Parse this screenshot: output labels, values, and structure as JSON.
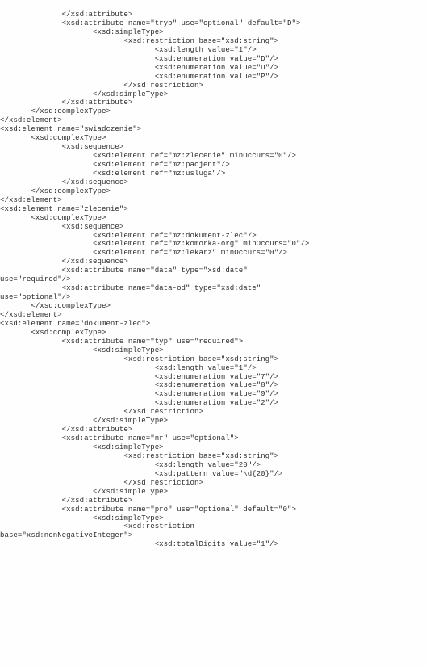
{
  "document": {
    "type": "scanned-code-listing",
    "language": "xsd",
    "page_background": "#fefefe",
    "text_color": "#2e2e2e",
    "indent_unit_spaces": 7,
    "lines": [
      "              </xsd:attribute>",
      "              <xsd:attribute name=\"tryb\" use=\"optional\" default=\"D\">",
      "                     <xsd:simpleType>",
      "                            <xsd:restriction base=\"xsd:string\">",
      "                                   <xsd:length value=\"1\"/>",
      "                                   <xsd:enumeration value=\"D\"/>",
      "                                   <xsd:enumeration value=\"U\"/>",
      "                                   <xsd:enumeration value=\"P\"/>",
      "                            </xsd:restriction>",
      "                     </xsd:simpleType>",
      "              </xsd:attribute>",
      "       </xsd:complexType>",
      "</xsd:element>",
      "<xsd:element name=\"swiadczenie\">",
      "       <xsd:complexType>",
      "              <xsd:sequence>",
      "                     <xsd:element ref=\"mz:zlecenie\" minOccurs=\"0\"/>",
      "                     <xsd:element ref=\"mz:pacjent\"/>",
      "                     <xsd:element ref=\"mz:usluga\"/>",
      "              </xsd:sequence>",
      "       </xsd:complexType>",
      "</xsd:element>",
      "<xsd:element name=\"zlecenie\">",
      "       <xsd:complexType>",
      "              <xsd:sequence>",
      "                     <xsd:element ref=\"mz:dokument-zlec\"/>",
      "                     <xsd:element ref=\"mz:komorka-org\" minOccurs=\"0\"/>",
      "                     <xsd:element ref=\"mz:lekarz\" minOccurs=\"0\"/>",
      "              </xsd:sequence>",
      "              <xsd:attribute name=\"data\" type=\"xsd:date\"",
      "use=\"required\"/>",
      "              <xsd:attribute name=\"data-od\" type=\"xsd:date\"",
      "use=\"optional\"/>",
      "       </xsd:complexType>",
      "</xsd:element>",
      "<xsd:element name=\"dokument-zlec\">",
      "       <xsd:complexType>",
      "              <xsd:attribute name=\"typ\" use=\"required\">",
      "                     <xsd:simpleType>",
      "                            <xsd:restriction base=\"xsd:string\">",
      "                                   <xsd:length value=\"1\"/>",
      "                                   <xsd:enumeration value=\"7\"/>",
      "                                   <xsd:enumeration value=\"8\"/>",
      "                                   <xsd:enumeration value=\"9\"/>",
      "                                   <xsd:enumeration value=\"2\"/>",
      "                            </xsd:restriction>",
      "                     </xsd:simpleType>",
      "              </xsd:attribute>",
      "              <xsd:attribute name=\"nr\" use=\"optional\">",
      "                     <xsd:simpleType>",
      "                            <xsd:restriction base=\"xsd:string\">",
      "                                   <xsd:length value=\"20\"/>",
      "                                   <xsd:pattern value=\"\\d{20}\"/>",
      "                            </xsd:restriction>",
      "                     </xsd:simpleType>",
      "              </xsd:attribute>",
      "              <xsd:attribute name=\"pro\" use=\"optional\" default=\"0\">",
      "                     <xsd:simpleType>",
      "                            <xsd:restriction",
      "base=\"xsd:nonNegativeInteger\">",
      "                                   <xsd:totalDigits value=\"1\"/>"
    ]
  }
}
